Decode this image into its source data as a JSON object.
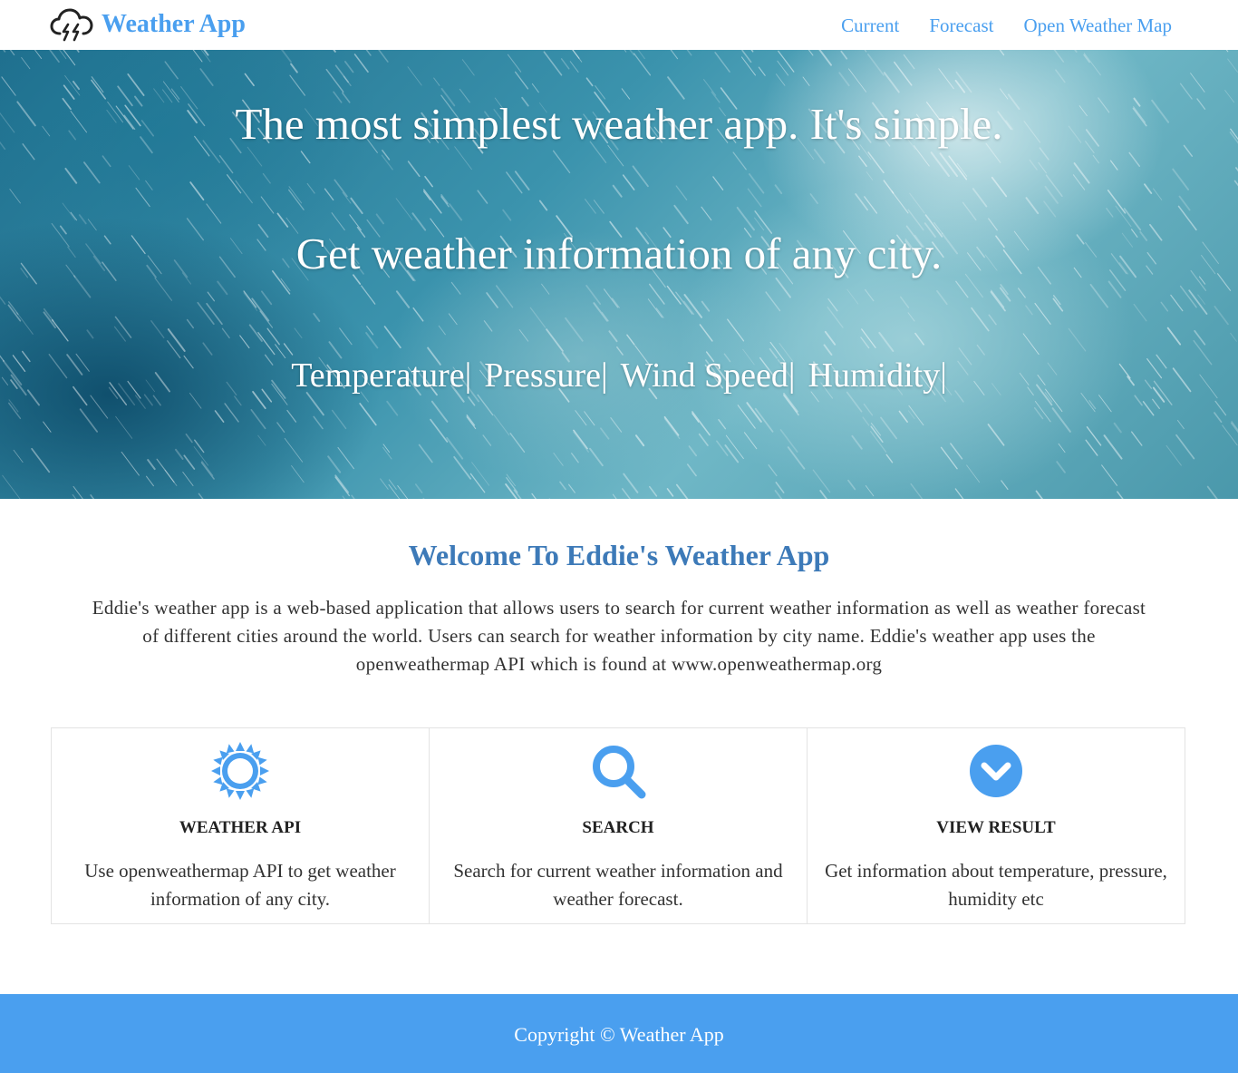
{
  "nav": {
    "brand": "Weather App",
    "brand_icon": "cloud-lightning-icon",
    "links": [
      "Current",
      "Forecast",
      "Open Weather Map"
    ]
  },
  "hero": {
    "title": "The most simplest weather app. It's simple.",
    "subtitle": "Get weather information of any city.",
    "features": [
      "Temperature|",
      "Pressure|",
      "Wind Speed|",
      "Humidity|"
    ]
  },
  "welcome": {
    "title": "Welcome To Eddie's Weather App",
    "text": "Eddie's weather app is a web-based application that allows users to search for current weather information as well as weather forecast of different cities around the world. Users can search for weather information by city name. Eddie's weather app uses the openweathermap API which is found at www.openweathermap.org"
  },
  "cards": [
    {
      "icon": "sun-icon",
      "title": "WEATHER API",
      "text": "Use openweathermap API to get weather information of any city."
    },
    {
      "icon": "search-icon",
      "title": "SEARCH",
      "text": "Search for current weather information and weather forecast."
    },
    {
      "icon": "chevron-down-circle-icon",
      "title": "VIEW RESULT",
      "text": "Get information about temperature, pressure, humidity etc"
    }
  ],
  "footer": {
    "text": "Copyright © Weather App"
  },
  "colors": {
    "accent": "#4a9fef",
    "welcome_title": "#3d7ab8"
  }
}
